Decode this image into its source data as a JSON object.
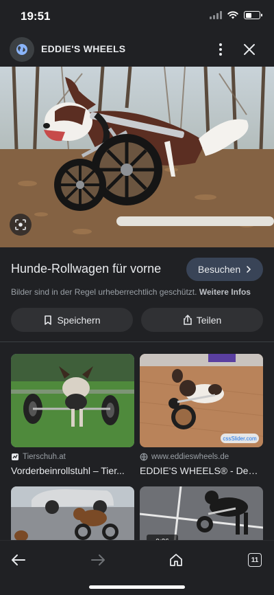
{
  "status_bar": {
    "time": "19:51"
  },
  "header": {
    "site_name": "EDDIE'S WHEELS",
    "site_icon": "globe-icon",
    "menu_icon": "more-vert-icon",
    "close_icon": "close-icon"
  },
  "hero": {
    "lens_icon": "lens-icon"
  },
  "detail": {
    "title": "Hunde-Rollwagen für vorne",
    "visit_label": "Besuchen",
    "copyright_text": "Bilder sind in der Regel urheberrechtlich geschützt.",
    "more_info_label": "Weitere Infos",
    "save_label": "Speichern",
    "share_label": "Teilen"
  },
  "results": [
    {
      "source": "Tierschuh.at",
      "title": "Vorderbeinrollstuhl – Tier..."
    },
    {
      "source": "www.eddieswheels.de",
      "title": "EDDIE'S WHEELS® - Deut..."
    },
    {
      "source": "",
      "title": ""
    },
    {
      "source": "",
      "title": "",
      "overlay": "0:26"
    }
  ],
  "watermark": "cssSlider.com",
  "bottom_nav": {
    "tab_count": "11",
    "icons": [
      "back-arrow-icon",
      "forward-arrow-icon",
      "home-icon",
      "tabs-icon"
    ]
  },
  "colors": {
    "background": "#202124",
    "visit_button": "#394457",
    "pill_button": "#303134"
  }
}
